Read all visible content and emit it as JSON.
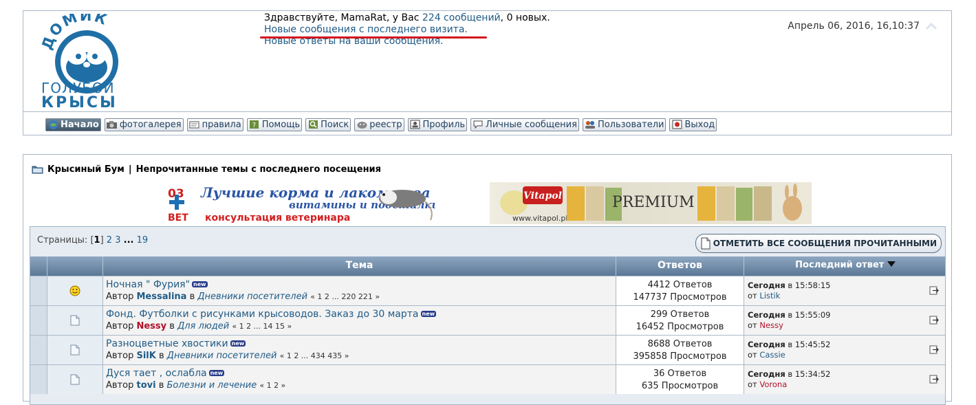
{
  "header": {
    "logo": {
      "top_word": "ДОМИК",
      "mid_word": "ГОЛУБОЙ",
      "bottom_word": "КРЫСЫ"
    },
    "greeting_prefix": "Здравствуйте, MamaRat, у Вас",
    "messages_link": "224 сообщений",
    "greeting_suffix": ", 0 новых.",
    "new_since_last_visit": "Новые сообщения с последнего визита.",
    "new_replies": "Новые ответы на ваши сообщения.",
    "datetime": "Апрель 06, 2016, 16,10:37"
  },
  "nav": [
    {
      "label": "Начало",
      "icon": "home-icon"
    },
    {
      "label": "фотогалерея",
      "icon": "camera-icon"
    },
    {
      "label": "правила",
      "icon": "scroll-icon"
    },
    {
      "label": "Помощь",
      "icon": "question-icon"
    },
    {
      "label": "Поиск",
      "icon": "search-icon"
    },
    {
      "label": "реестр",
      "icon": "rat-icon"
    },
    {
      "label": "Профиль",
      "icon": "profile-icon"
    },
    {
      "label": "Личные сообщения",
      "icon": "message-icon"
    },
    {
      "label": "Пользователи",
      "icon": "users-icon"
    },
    {
      "label": "Выход",
      "icon": "exit-icon"
    }
  ],
  "breadcrumb": {
    "forum": "Крысиный Бум",
    "separator": "|",
    "page": "Непрочитанные темы с последнего посещения"
  },
  "banners": {
    "feed": {
      "line1": "Лучшие корма и лакомства",
      "line2": "витамины и подстилки",
      "line3": "консультация ветеринара",
      "logo_top": "03",
      "logo_bottom": "ВЕТ"
    },
    "vitapol": {
      "brand": "Vitapol",
      "tagline": "PREMIUM",
      "url": "www.vitapol.pl"
    }
  },
  "pagination": {
    "label": "Страницы:",
    "current": "1",
    "pages": [
      "2",
      "3"
    ],
    "ellipsis": "...",
    "last": "19"
  },
  "mark_all_read": "ОТМЕТИТЬ ВСЕ СООБЩЕНИЯ ПРОЧИТАННЫМИ",
  "columns": {
    "topic": "Тема",
    "replies": "Ответов",
    "last_post": "Последний ответ"
  },
  "colors": {
    "header_bar": "#5b7896",
    "link": "#1f5b86",
    "highlight": "#d4151b"
  },
  "topics": [
    {
      "icon": "smiley-icon",
      "title": "Ночная \" Фурия\"",
      "badge": "new",
      "by": "Автор",
      "author": "Messalina",
      "author_red": false,
      "in": "в",
      "forum": "Дневники посетителей",
      "pages": "« 1 2 ... 220 221 »",
      "replies": "4412 Ответов",
      "views": "147737 Просмотров",
      "lr_day": "Сегодня",
      "lr_time": "в 15:58:15",
      "lr_from": "от",
      "lr_user": "Listik",
      "lr_red": false
    },
    {
      "icon": "document-icon",
      "title": "Фонд. Футболки с рисунками крысоводов. Заказ до 30 марта",
      "badge": "new",
      "by": "Автор",
      "author": "Nessy",
      "author_red": true,
      "in": "в",
      "forum": "Для людей",
      "pages": "« 1 2 ... 14 15 »",
      "replies": "299 Ответов",
      "views": "16452 Просмотров",
      "lr_day": "Сегодня",
      "lr_time": "в 15:55:09",
      "lr_from": "от",
      "lr_user": "Nessy",
      "lr_red": true
    },
    {
      "icon": "document-icon",
      "title": "Разноцветные хвостики",
      "badge": "new",
      "by": "Автор",
      "author": "SilK",
      "author_red": false,
      "in": "в",
      "forum": "Дневники посетителей",
      "pages": "« 1 2 ... 434 435 »",
      "replies": "8688 Ответов",
      "views": "395858 Просмотров",
      "lr_day": "Сегодня",
      "lr_time": "в 15:45:52",
      "lr_from": "от",
      "lr_user": "Cassie",
      "lr_red": false
    },
    {
      "icon": "document-icon",
      "title": "Дуся тает , ослабла",
      "badge": "new",
      "by": "Автор",
      "author": "tovi",
      "author_red": false,
      "in": "в",
      "forum": "Болезни и лечение",
      "pages": "« 1 2 »",
      "replies": "36 Ответов",
      "views": "635 Просмотров",
      "lr_day": "Сегодня",
      "lr_time": "в 15:34:52",
      "lr_from": "от",
      "lr_user": "Vorona",
      "lr_red": true
    }
  ]
}
